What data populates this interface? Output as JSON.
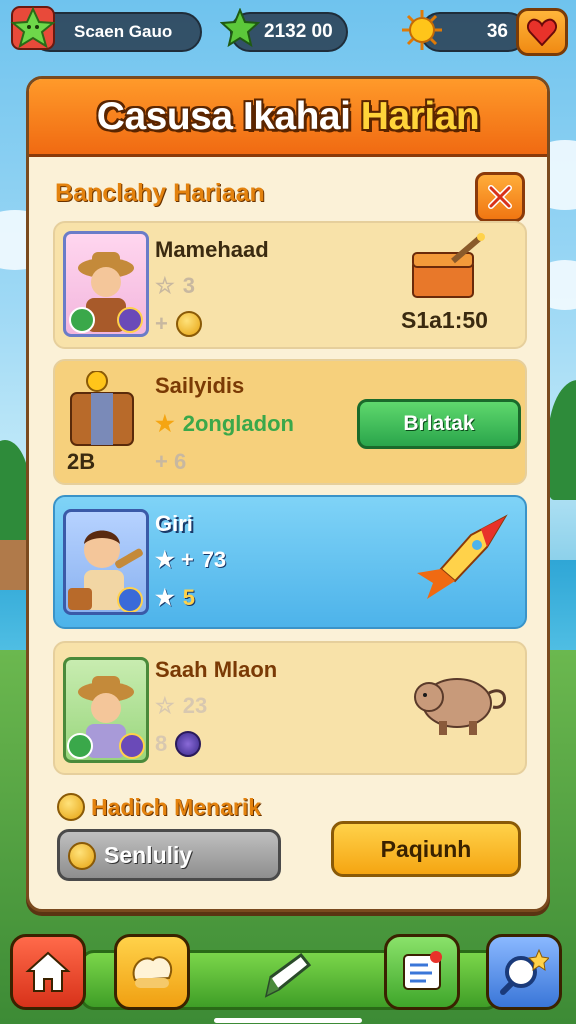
{
  "hud": {
    "player_name": "Scaen Gauo",
    "stars": "2132 00",
    "lives": "36"
  },
  "panel": {
    "title_main": "Casusa Ikahai",
    "title_highlight": "Harian",
    "subtitle": "Banclahy Hariaan"
  },
  "tasks": [
    {
      "name": "Mamehaad",
      "line1": "3",
      "line2": "+",
      "reward": "S1a1:50"
    },
    {
      "name": "Sailyidis",
      "line1": "2ongladon",
      "line2": "+ 6",
      "badge": "2B",
      "action": "Brlatak"
    },
    {
      "name": "Giri",
      "line1": "73",
      "line2": "5"
    },
    {
      "name": "Saah Mlaon",
      "line1": "23",
      "line2": "8"
    }
  ],
  "footer": {
    "bonus_label": "Hadich Menarik",
    "grey_button": "Senluliy",
    "yellow_button": "Paqiunh"
  },
  "colors": {
    "header_orange": "#f06a12",
    "panel_bg": "#fbf1d7",
    "claim_green": "#2aa54b",
    "accent_yellow": "#f5a512",
    "highlight_blue": "#4db3ea"
  },
  "icons": [
    "star-badge-icon",
    "star-icon",
    "sun-icon",
    "heart-icon",
    "close-icon",
    "treasure-chest-icon",
    "rocket-icon",
    "boar-icon",
    "home-icon",
    "food-icon",
    "pencil-icon",
    "task-list-icon",
    "search-icon",
    "coin-icon"
  ]
}
